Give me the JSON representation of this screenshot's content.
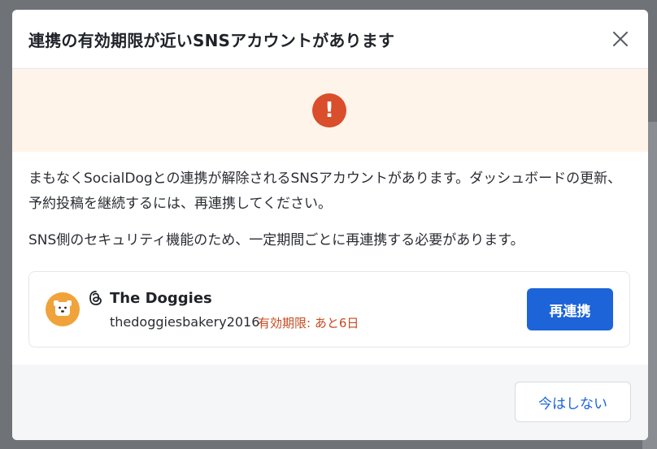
{
  "modal": {
    "title": "連携の有効期限が近いSNSアカウントがあります",
    "close_icon": "close-icon",
    "alert_icon": "exclamation-icon",
    "alert_glyph": "!",
    "message_1": "まもなくSocialDogとの連携が解除されるSNSアカウントがあります。ダッシュボードの更新、予約投稿を継続するには、再連携してください。",
    "message_2": "SNS側のセキュリティ機能のため、一定期間ごとに再連携する必要があります。",
    "account": {
      "platform_icon": "threads-icon",
      "avatar_icon": "dog-avatar-icon",
      "name": "The Doggies",
      "handle": "thedoggiesbakery2016",
      "expiry": "有効期限: あと6日",
      "reconnect_label": "再連携"
    },
    "footer": {
      "later_label": "今はしない"
    }
  },
  "colors": {
    "alert_bg": "#fff4ea",
    "alert_icon": "#d94e2b",
    "primary": "#1c64d8",
    "expiry_text": "#c64a1f"
  }
}
